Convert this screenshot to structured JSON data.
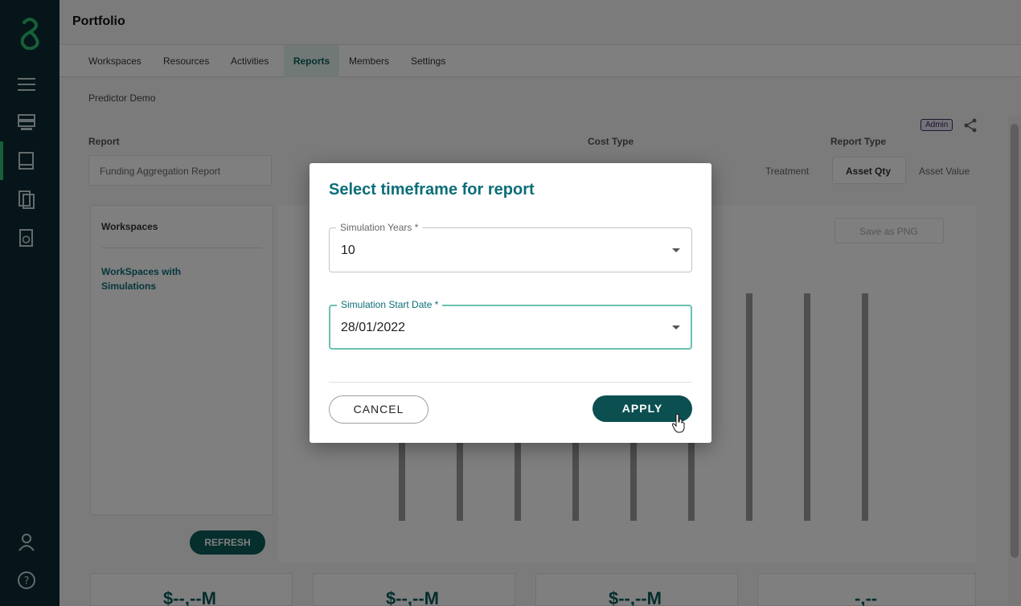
{
  "header": {
    "title": "Portfolio"
  },
  "tabs": [
    {
      "label": "Workspaces"
    },
    {
      "label": "Resources"
    },
    {
      "label": "Activities"
    },
    {
      "label": "Reports",
      "active": true
    },
    {
      "label": "Members"
    },
    {
      "label": "Settings"
    }
  ],
  "breadcrumb": "Predictor Demo",
  "badge": "Admin",
  "background": {
    "report_label": "Report",
    "report_value": "Funding Aggregation Report",
    "cost_type_label": "Cost Type",
    "report_type_label": "Report Type",
    "report_type_options": [
      "Asset Qty",
      "Asset Value"
    ],
    "cost_type_options": [
      "Treatment"
    ],
    "workspaces_label": "Workspaces",
    "workspaces_with_sim": "WorkSpaces with Simulations",
    "refresh_label": "REFRESH",
    "save_png_label": "Save as PNG",
    "card_values": [
      "$--,--M",
      "$--,--M",
      "$--,--M",
      "-,--"
    ]
  },
  "dialog": {
    "title": "Select timeframe for report",
    "sim_years": {
      "label": "Simulation Years *",
      "value": "10"
    },
    "sim_start": {
      "label": "Simulation Start Date *",
      "value": "28/01/2022"
    },
    "cancel_label": "CANCEL",
    "apply_label": "APPLY"
  },
  "colors": {
    "rail": "#0a2a33",
    "accent": "#0b6e78",
    "apply": "#0b4f50",
    "logo": "#2fbf71"
  }
}
